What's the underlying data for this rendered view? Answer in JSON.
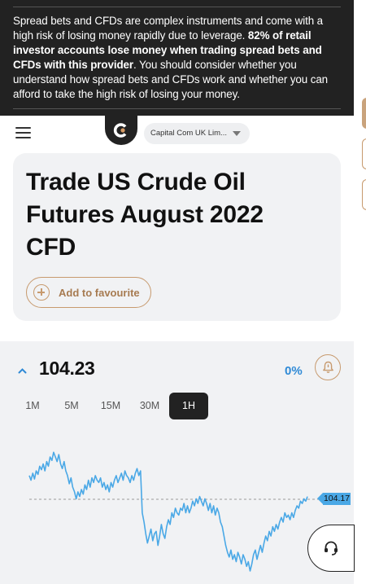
{
  "risk_warning": {
    "text_start": "Spread bets and CFDs are complex instruments and come with a high risk of losing money rapidly due to leverage. ",
    "text_bold": "82% of retail investor accounts lose money when trading spread bets and CFDs with this provider",
    "text_end": ". You should consider whether you understand how spread bets and CFDs work and whether you can afford to take the high risk of losing your money."
  },
  "header": {
    "menu_icon": "hamburger-icon",
    "logo_icon": "capital-com-logo",
    "entity_selector": "Capital Com UK Lim..."
  },
  "instrument": {
    "title": "Trade US Crude Oil Futures August 2022 CFD",
    "favourite_label": "Add to favourite"
  },
  "quote": {
    "price": "104.23",
    "change": "0%",
    "direction_icon": "chevron-up-icon",
    "alert_icon": "bell-icon"
  },
  "timeframes": {
    "options": [
      "1M",
      "5M",
      "15M",
      "30M",
      "1H"
    ],
    "selected": "1H"
  },
  "chart_data": {
    "type": "line",
    "current_price_label": "104.17",
    "line_color": "#4aa8e6",
    "values": [
      0.62,
      0.58,
      0.64,
      0.59,
      0.66,
      0.63,
      0.7,
      0.67,
      0.72,
      0.66,
      0.74,
      0.7,
      0.78,
      0.75,
      0.82,
      0.78,
      0.74,
      0.8,
      0.72,
      0.68,
      0.74,
      0.66,
      0.62,
      0.55,
      0.6,
      0.52,
      0.48,
      0.42,
      0.48,
      0.44,
      0.5,
      0.46,
      0.54,
      0.5,
      0.58,
      0.52,
      0.6,
      0.56,
      0.62,
      0.58,
      0.56,
      0.6,
      0.52,
      0.56,
      0.5,
      0.54,
      0.48,
      0.56,
      0.52,
      0.58,
      0.62,
      0.56,
      0.6,
      0.64,
      0.58,
      0.66,
      0.62,
      0.6,
      0.56,
      0.62,
      0.58,
      0.64,
      0.68,
      0.62,
      0.66,
      0.3,
      0.22,
      0.12,
      0.04,
      0.1,
      0.16,
      0.06,
      0.12,
      0.14,
      0.02,
      0.1,
      0.2,
      0.12,
      0.08,
      0.18,
      0.24,
      0.2,
      0.3,
      0.26,
      0.34,
      0.3,
      0.28,
      0.34,
      0.32,
      0.38,
      0.3,
      0.36,
      0.3,
      0.34,
      0.4,
      0.36,
      0.42,
      0.38,
      0.44,
      0.4,
      0.36,
      0.42,
      0.38,
      0.32,
      0.38,
      0.3,
      0.36,
      0.28,
      0.34,
      0.3,
      0.22,
      0.18,
      0.1,
      0.02,
      -0.04,
      -0.08,
      -0.02,
      -0.1,
      -0.06,
      -0.12,
      -0.04,
      -0.08,
      -0.14,
      -0.06,
      -0.1,
      -0.16,
      -0.12,
      -0.2,
      -0.14,
      -0.06,
      -0.02,
      -0.1,
      -0.04,
      0.02,
      -0.04,
      0.04,
      0.1,
      0.06,
      0.14,
      0.1,
      0.18,
      0.14,
      0.2,
      0.16,
      0.22,
      0.26,
      0.22,
      0.3,
      0.26,
      0.28,
      0.24,
      0.3,
      0.26,
      0.32,
      0.36,
      0.34,
      0.4,
      0.38,
      0.42,
      0.4,
      0.44
    ]
  },
  "support": {
    "icon": "headset-icon"
  },
  "colors": {
    "accent": "#c79a6e",
    "dark": "#222222",
    "panel": "#f1f2f4",
    "chart_line": "#4aa8e6"
  }
}
